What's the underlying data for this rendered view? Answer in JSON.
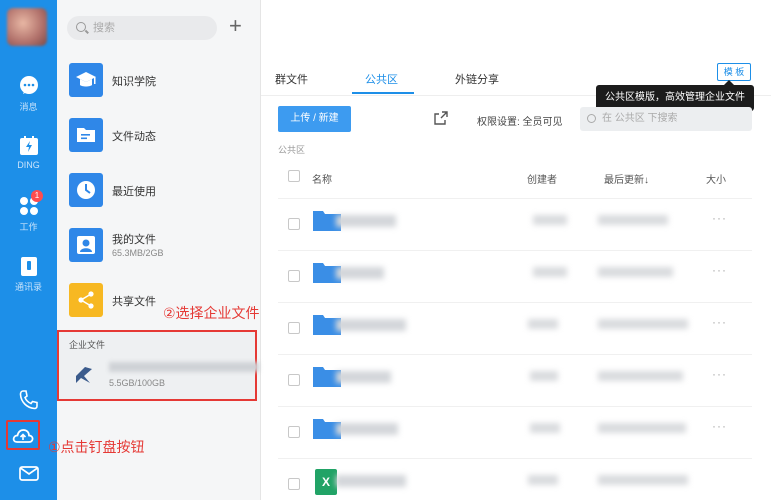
{
  "rail": {
    "items": [
      {
        "label": "消息",
        "icon": "chat-icon"
      },
      {
        "label": "DING",
        "icon": "ding-icon"
      },
      {
        "label": "工作",
        "icon": "apps-icon",
        "badge": "1"
      },
      {
        "label": "通讯录",
        "icon": "contacts-icon"
      }
    ],
    "bottom_icons": [
      "phone-icon",
      "cloud-drive-icon",
      "mail-icon"
    ]
  },
  "middle": {
    "search_placeholder": "搜索",
    "plus_label": "+",
    "items": [
      {
        "label": "知识学院",
        "icon": "graduation-cap-icon"
      },
      {
        "label": "文件动态",
        "icon": "folder-activity-icon"
      },
      {
        "label": "最近使用",
        "icon": "clock-icon"
      },
      {
        "label": "我的文件",
        "sub": "65.3MB/2GB",
        "icon": "person-icon"
      },
      {
        "label": "共享文件",
        "icon": "share-icon"
      }
    ],
    "enterprise": {
      "title": "企业文件",
      "size": "5.5GB/100GB"
    }
  },
  "annotations": {
    "step1": "①点击钉盘按钮",
    "step2": "②选择企业文件"
  },
  "main": {
    "tabs": [
      {
        "label": "群文件",
        "active": false
      },
      {
        "label": "公共区",
        "active": true
      },
      {
        "label": "外链分享",
        "active": false
      }
    ],
    "template_button": "模 板",
    "tooltip": "公共区模版，高效管理企业文件",
    "upload_button": "上传 / 新建",
    "permission": "权限设置: 全员可见",
    "search_placeholder": "在 公共区 下搜索",
    "breadcrumb": "公共区",
    "columns": {
      "name": "名称",
      "creator": "创建者",
      "updated": "最后更新↓",
      "size": "大小"
    },
    "row_action": "···"
  },
  "colors": {
    "rail": "#1d8fe8",
    "accent": "#1d8fe8",
    "annotation": "#e53935",
    "excel": "#21a366"
  }
}
